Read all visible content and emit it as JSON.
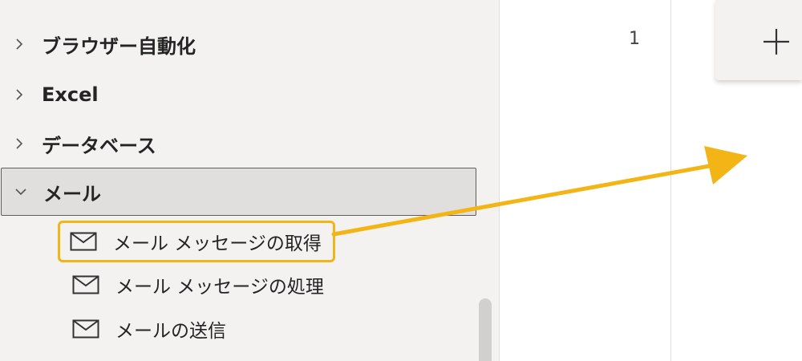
{
  "sidebar": {
    "categories": [
      {
        "label": "ブラウザー自動化",
        "expanded": false
      },
      {
        "label": "Excel",
        "expanded": false
      },
      {
        "label": "データベース",
        "expanded": false
      },
      {
        "label": "メール",
        "expanded": true
      }
    ],
    "actions": [
      {
        "label": "メール メッセージの取得",
        "icon": "mail-icon",
        "highlighted": true
      },
      {
        "label": "メール メッセージの処理",
        "icon": "mail-icon",
        "highlighted": false
      },
      {
        "label": "メールの送信",
        "icon": "mail-icon",
        "highlighted": false
      }
    ]
  },
  "editor": {
    "line_number": "1"
  },
  "add_button": {
    "icon": "plus-icon"
  },
  "colors": {
    "highlight": "#f3b515",
    "arrow": "#f3b515",
    "sidebar_bg": "#f3f2f1",
    "selected_bg": "#e1dfdd"
  }
}
